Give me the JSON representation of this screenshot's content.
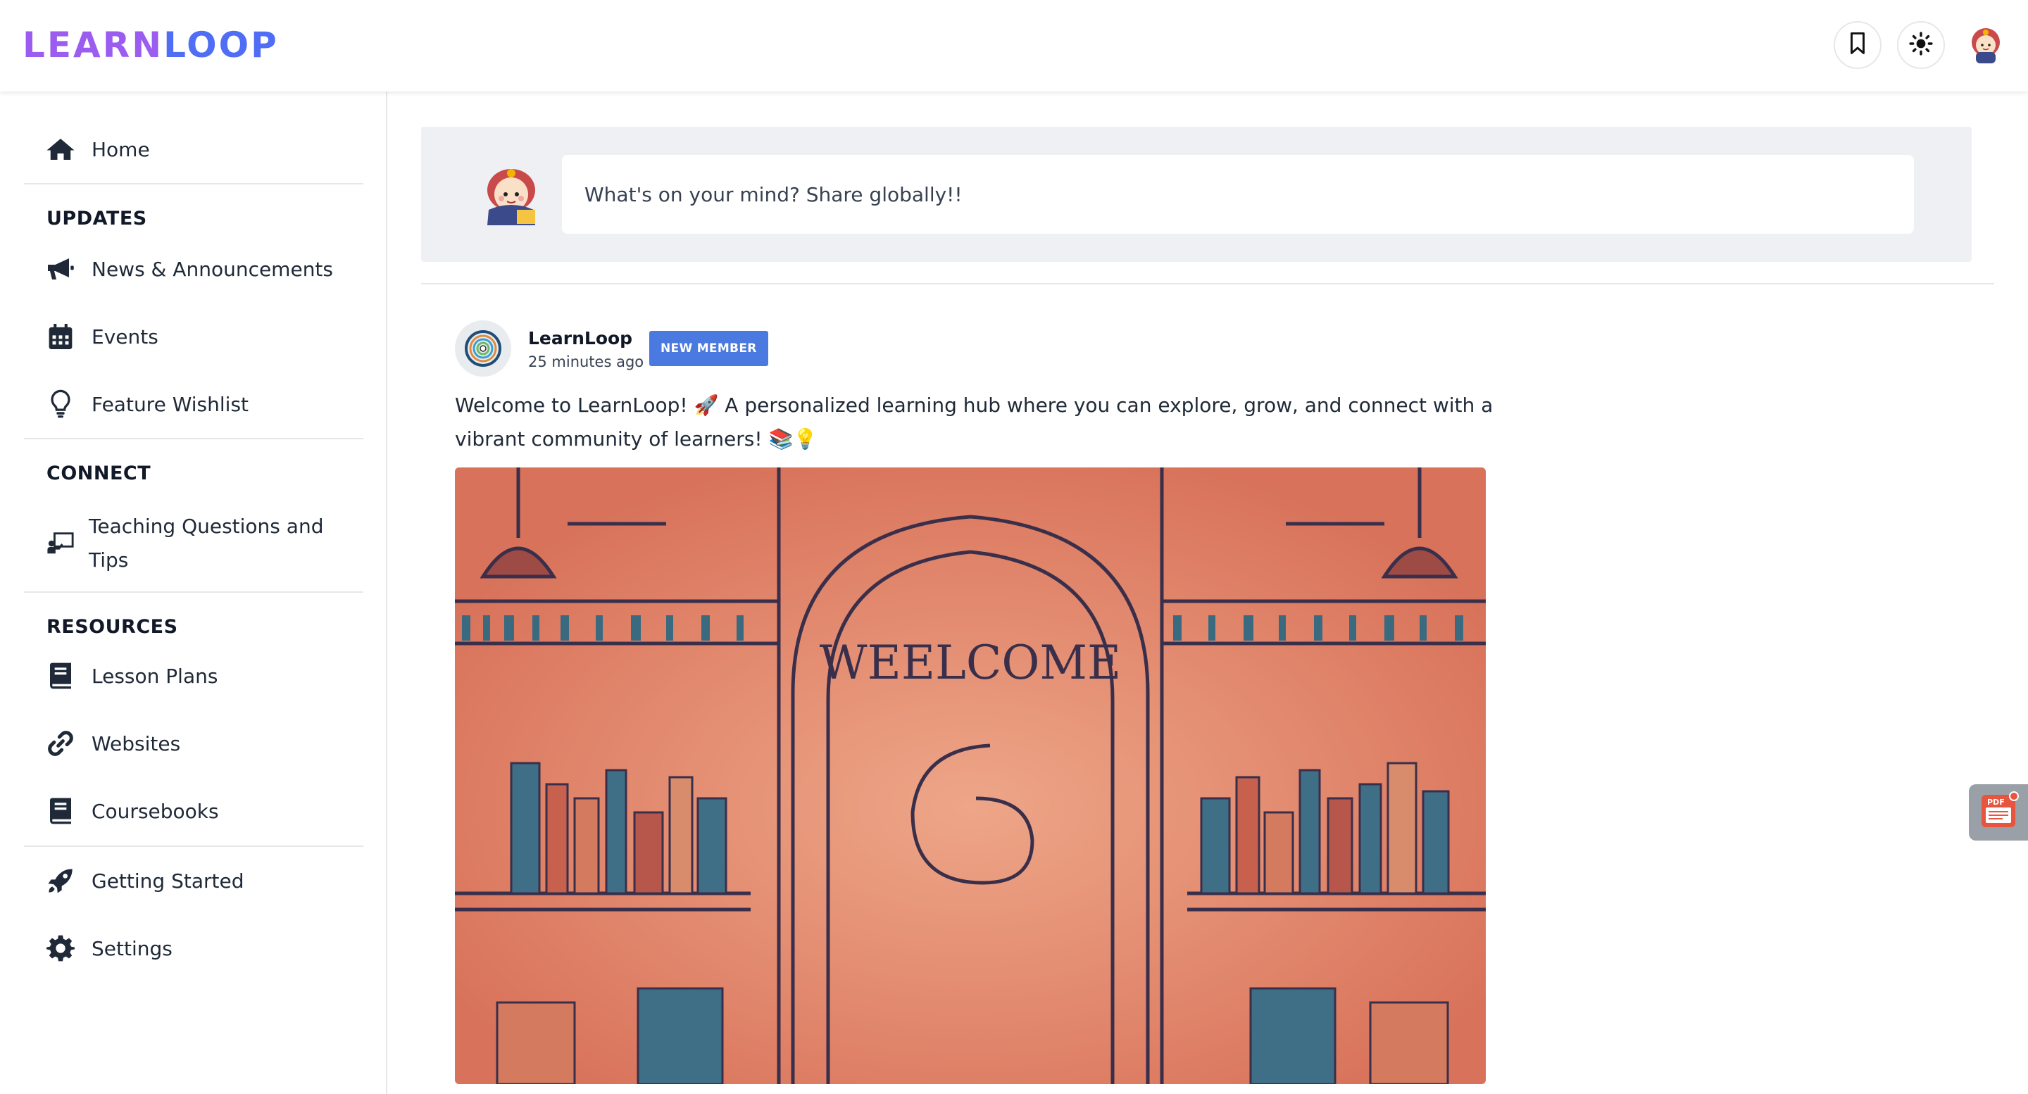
{
  "app": {
    "logo_part1": "LEARN",
    "logo_part2": "LOOP"
  },
  "colors": {
    "logo_purple": "#9b5cf0",
    "logo_blue": "#4f6df5",
    "badge_blue": "#4a7ae0",
    "composer_bg": "#eff0f3",
    "illustration": "#e0866b"
  },
  "header": {
    "icons": [
      "bookmark-icon",
      "sun-icon",
      "user-avatar"
    ]
  },
  "sidebar": {
    "home": "Home",
    "sections": [
      {
        "title": "UPDATES",
        "items": [
          "News & Announcements",
          "Events",
          "Feature Wishlist"
        ]
      },
      {
        "title": "CONNECT",
        "items": [
          "Teaching Questions and Tips"
        ]
      },
      {
        "title": "RESOURCES",
        "items": [
          "Lesson Plans",
          "Websites",
          "Coursebooks"
        ]
      }
    ],
    "bottom_items": [
      "Getting Started",
      "Settings"
    ],
    "labels": {
      "updates": "UPDATES",
      "news": "News & Announcements",
      "events": "Events",
      "wishlist": "Feature Wishlist",
      "connect": "CONNECT",
      "teaching_1": "Teaching Questions and",
      "teaching_2": "Tips",
      "resources": "RESOURCES",
      "lesson_plans": "Lesson Plans",
      "websites": "Websites",
      "coursebooks": "Coursebooks",
      "getting_started": "Getting Started",
      "settings": "Settings"
    }
  },
  "composer": {
    "placeholder": "What's on your mind? Share globally!!"
  },
  "post": {
    "author": "LearnLoop",
    "time": "25 minutes ago",
    "badge": "NEW MEMBER",
    "text": "Welcome to LearnLoop! 🚀 A personalized learning hub where you can explore, grow, and connect with a vibrant community of learners! 📚💡",
    "image_text": "WEELCOME"
  },
  "floating": {
    "pdf_label": "PDF"
  }
}
